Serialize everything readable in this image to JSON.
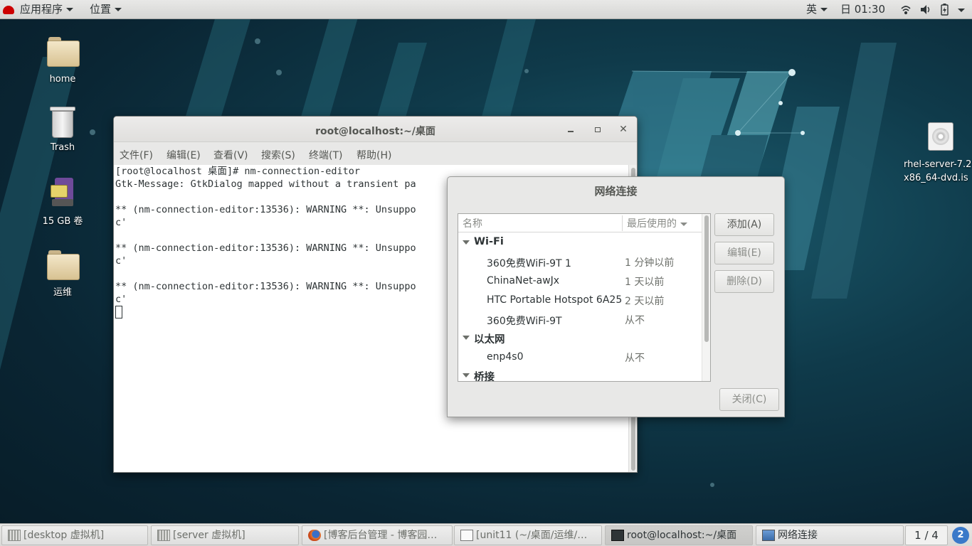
{
  "topbar": {
    "applications": "应用程序",
    "places": "位置",
    "input_method": "英",
    "clock": "日 01:30"
  },
  "desktop": {
    "icons": [
      {
        "label": "home",
        "icon": "home-folder-icon"
      },
      {
        "label": "Trash",
        "icon": "trash-icon"
      },
      {
        "label": "15 GB 卷",
        "icon": "drive-icon"
      },
      {
        "label": "运维",
        "icon": "folder-icon"
      }
    ],
    "dvd": {
      "line1": "rhel-server-7.2-",
      "line2": "x86_64-dvd.is",
      "icon": "disc-icon"
    }
  },
  "terminal": {
    "title": "root@localhost:~/桌面",
    "menu": [
      "文件(F)",
      "编辑(E)",
      "查看(V)",
      "搜索(S)",
      "终端(T)",
      "帮助(H)"
    ],
    "lines": [
      "[root@localhost 桌面]# nm-connection-editor",
      "Gtk-Message: GtkDialog mapped without a transient pa",
      "",
      "** (nm-connection-editor:13536): WARNING **: Unsuppo",
      "c'",
      "",
      "** (nm-connection-editor:13536): WARNING **: Unsuppo",
      "c'",
      "",
      "** (nm-connection-editor:13536): WARNING **: Unsuppo",
      "c'"
    ]
  },
  "network_dialog": {
    "title": "网络连接",
    "col_name": "名称",
    "col_last_used": "最后使用的",
    "groups": [
      {
        "name": "Wi-Fi",
        "items": [
          {
            "name": "360免费WiFi-9T 1",
            "last_used": "1 分钟以前"
          },
          {
            "name": "ChinaNet-awJx",
            "last_used": "1 天以前"
          },
          {
            "name": "HTC Portable Hotspot 6A25",
            "last_used": "2 天以前"
          },
          {
            "name": "360免费WiFi-9T",
            "last_used": "从不"
          }
        ]
      },
      {
        "name": "以太网",
        "items": [
          {
            "name": "enp4s0",
            "last_used": "从不"
          }
        ]
      },
      {
        "name": "桥接",
        "items": []
      }
    ],
    "buttons": {
      "add": "添加(A)",
      "edit": "编辑(E)",
      "delete": "删除(D)",
      "close": "关闭(C)"
    }
  },
  "taskbar": {
    "tasks": [
      {
        "label": "[desktop 虚拟机]",
        "icon": "vm-icon",
        "active": false
      },
      {
        "label": "[server 虚拟机]",
        "icon": "vm-icon",
        "active": false
      },
      {
        "label": "[博客后台管理 - 博客园…",
        "icon": "firefox-icon",
        "active": false
      },
      {
        "label": "[unit11 (~/桌面/运维/…",
        "icon": "text-editor-icon",
        "active": false
      },
      {
        "label": "root@localhost:~/桌面",
        "icon": "terminal-icon",
        "active": true
      },
      {
        "label": "网络连接",
        "icon": "network-icon",
        "active": false
      }
    ],
    "workspace": "1 / 4",
    "notifications": "2"
  }
}
